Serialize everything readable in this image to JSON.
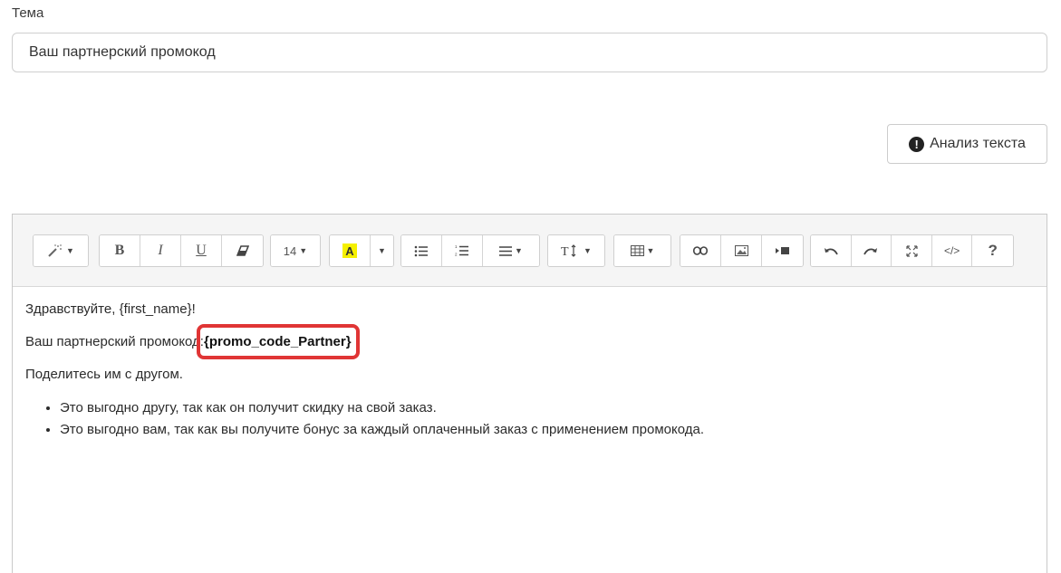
{
  "subject": {
    "label": "Тема",
    "value": "Ваш партнерский промокод"
  },
  "analyze_button": {
    "label": "Анализ текста"
  },
  "toolbar": {
    "font_size": "14",
    "bold": "B",
    "italic": "I",
    "underline": "U",
    "help": "?"
  },
  "body": {
    "greeting": "Здравствуйте, {first_name}!",
    "promo_prefix": "Ваш партнерский промокод:",
    "promo_code": "{promo_code_Partner}",
    "share": "Поделитесь им с другом.",
    "bullets": [
      "Это выгодно другу, так как он получит скидку на свой заказ.",
      "Это выгодно вам, так как вы получите бонус за каждый оплаченный заказ с применением промокода."
    ]
  },
  "colors": {
    "highlight_border": "#e03535",
    "text_color_swatch": "#f5f000"
  }
}
